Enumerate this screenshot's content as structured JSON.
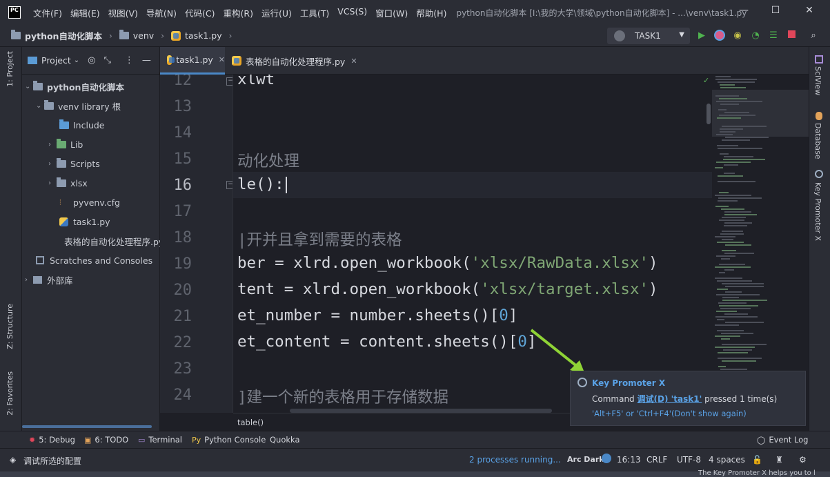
{
  "app": {
    "logo_text": "PC",
    "window_title": "python自动化脚本 [I:\\我的大学\\领域\\python自动化脚本] - ...\\venv\\task1.py",
    "menu": [
      "文件(F)",
      "编辑(E)",
      "视图(V)",
      "导航(N)",
      "代码(C)",
      "重构(R)",
      "运行(U)",
      "工具(T)",
      "VCS(S)",
      "窗口(W)",
      "帮助(H)"
    ],
    "controls": {
      "minimize": "—",
      "maximize": "☐",
      "close": "✕"
    }
  },
  "navbar": {
    "breadcrumbs": [
      "python自动化脚本",
      "venv",
      "task1.py"
    ],
    "run_config": "TASK1"
  },
  "left_stripe": {
    "project": "1: Project",
    "structure": "Z: Structure",
    "favorites": "2: Favorites"
  },
  "project_panel": {
    "title": "Project",
    "tree": [
      {
        "label": "python自动化脚本",
        "depth": 0,
        "expanded": true,
        "icon": "folder-icon"
      },
      {
        "label": "venv  library 根",
        "depth": 1,
        "expanded": true,
        "icon": "folder-icon"
      },
      {
        "label": "Include",
        "depth": 2,
        "icon": "folder-blue-icon"
      },
      {
        "label": "Lib",
        "depth": 2,
        "expanded": false,
        "icon": "folder-green-icon"
      },
      {
        "label": "Scripts",
        "depth": 2,
        "expanded": false,
        "icon": "folder-icon"
      },
      {
        "label": "xlsx",
        "depth": 2,
        "expanded": false,
        "icon": "folder-icon"
      },
      {
        "label": "pyvenv.cfg",
        "depth": 2,
        "icon": "config-file-icon"
      },
      {
        "label": "task1.py",
        "depth": 2,
        "icon": "python-file-icon"
      },
      {
        "label": "表格的自动化处理程序.py",
        "depth": 2,
        "icon": "python-file-icon"
      },
      {
        "label": "Scratches and Consoles",
        "depth": 0,
        "icon": "scratches-icon"
      },
      {
        "label": "外部库",
        "depth": 0,
        "expanded": false,
        "icon": "library-icon"
      }
    ]
  },
  "editor": {
    "tabs": [
      {
        "label": "task1.py",
        "active": true
      },
      {
        "label": "表格的自动化处理程序.py",
        "active": false
      }
    ],
    "lines": [
      {
        "n": "12",
        "text": "xlwt"
      },
      {
        "n": "13",
        "text": ""
      },
      {
        "n": "14",
        "text": ""
      },
      {
        "n": "15",
        "text": "动化处理",
        "comment": true
      },
      {
        "n": "16",
        "text": "le():",
        "current": true
      },
      {
        "n": "17",
        "text": ""
      },
      {
        "n": "18",
        "text": "|开并且拿到需要的表格",
        "comment": true
      },
      {
        "n": "19",
        "pre": "ber = xlrd.open_workbook(",
        "str": "'xlsx/RawData.xlsx'",
        "post": ")"
      },
      {
        "n": "20",
        "pre": "tent = xlrd.open_workbook(",
        "str": "'xlsx/target.xlsx'",
        "post": ")"
      },
      {
        "n": "21",
        "pre": "et_number = number.sheets()[",
        "num": "0",
        "post": "]"
      },
      {
        "n": "22",
        "pre": "et_content = content.sheets()[",
        "num": "0",
        "post": "]"
      },
      {
        "n": "23",
        "text": ""
      },
      {
        "n": "24",
        "text": "]建一个新的表格用于存储数据",
        "comment": true
      }
    ],
    "breadcrumb": "table()"
  },
  "right_stripe": {
    "sciview": "SciView",
    "database": "Database",
    "key_promoter": "Key Promoter X"
  },
  "notification": {
    "title": "Key Promoter X",
    "msg_prefix": "Command ",
    "command_link": "调试(D) 'task1'",
    "msg_suffix": " pressed 1 time(s)",
    "shortcut": "'Alt+F5' or 'Ctrl+F4'",
    "dont_show": "(Don't show again)"
  },
  "toolwindows": {
    "debug": "5: Debug",
    "todo": "6: TODO",
    "terminal": "Terminal",
    "python_console": "Python Console",
    "quokka": "Quokka",
    "event_log": "Event Log"
  },
  "statusbar": {
    "message": "调试所选的配置",
    "processes": "2 processes running...",
    "theme": "Arc Dark",
    "position": "16:13",
    "line_sep": "CRLF",
    "encoding": "UTF-8",
    "indent": "4 spaces"
  },
  "background_hint": "The Key Promoter X helps you to l",
  "colors": {
    "accent": "#4a88c7",
    "link": "#5aa2e6",
    "string": "#7fa674",
    "number": "#5fa4d6"
  }
}
